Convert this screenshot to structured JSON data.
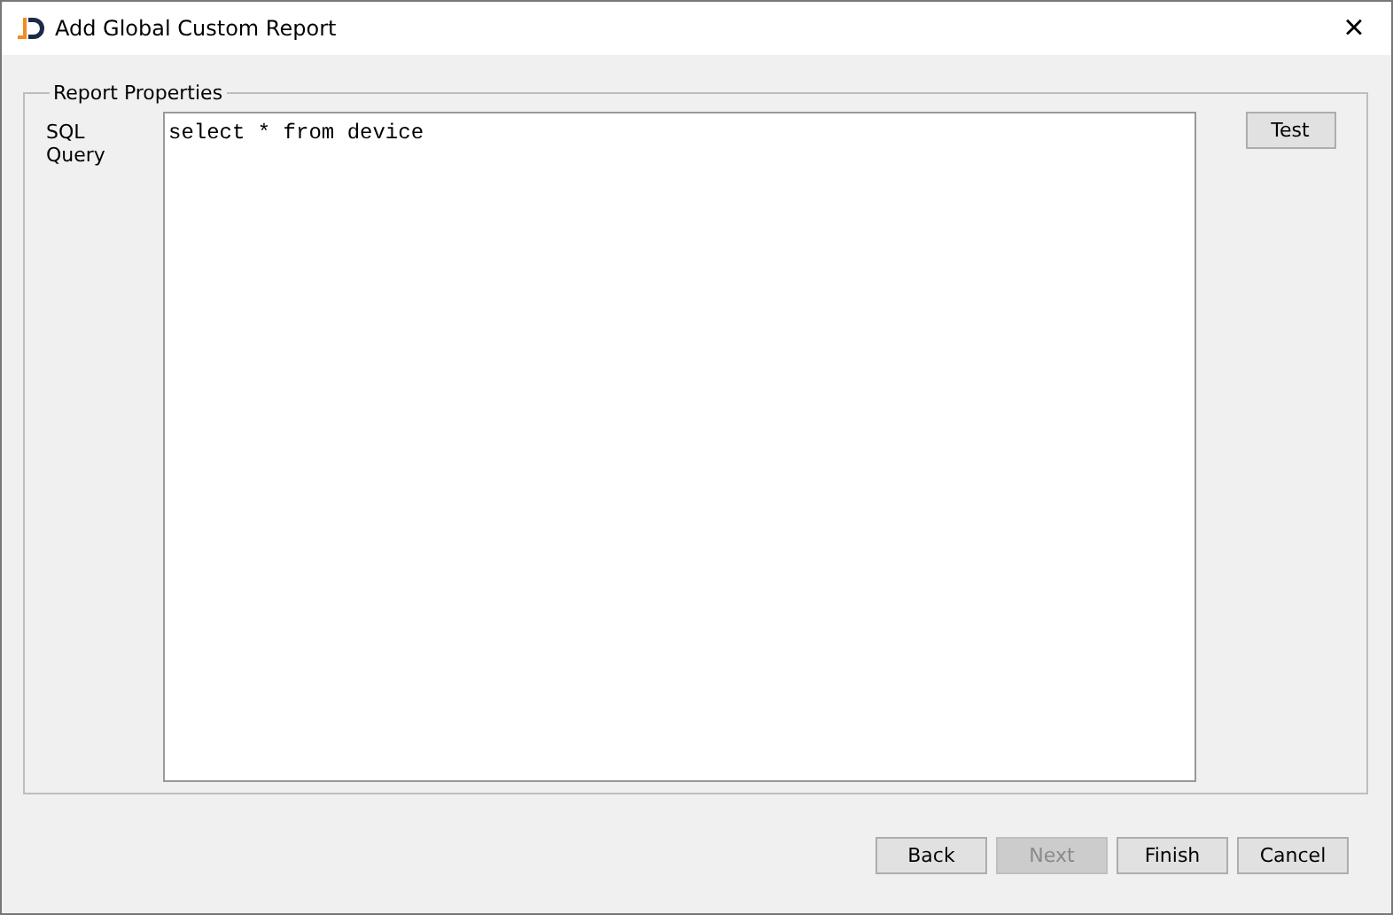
{
  "window": {
    "title": "Add Global Custom Report",
    "close": "×"
  },
  "group": {
    "title": "Report Properties",
    "label": "SQL Query",
    "query": "select * from device",
    "test_button": "Test"
  },
  "buttons": [
    {
      "label": "Back",
      "disabled": false
    },
    {
      "label": "Next",
      "disabled": true
    },
    {
      "label": "Finish",
      "disabled": false
    },
    {
      "label": "Cancel",
      "disabled": false
    }
  ]
}
